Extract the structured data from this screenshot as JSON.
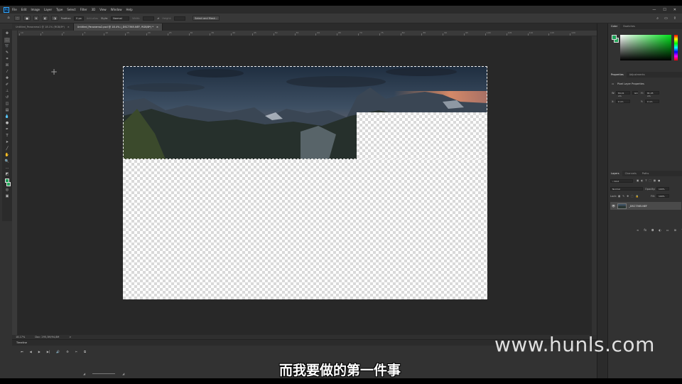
{
  "menubar": {
    "logo": "Ps",
    "items": [
      "File",
      "Edit",
      "Image",
      "Layer",
      "Type",
      "Select",
      "Filter",
      "3D",
      "View",
      "Window",
      "Help"
    ],
    "window_controls": [
      "—",
      "☐",
      "✕"
    ]
  },
  "options": {
    "feather_label": "Feather:",
    "feather_value": "0 px",
    "antialias_label": "Anti-alias",
    "style_label": "Style:",
    "style_value": "Normal",
    "width_label": "Width:",
    "height_label": "Height:",
    "select_mask_label": "Select and Mask..."
  },
  "tabs": [
    {
      "label": "Untitled_Panorama1 @ 18.1% (RGB/8*)",
      "close": "×"
    },
    {
      "label": "Untitled_Panorama2.psd @ 18.4% (_DSC7365.NEF, RGB/8*) *",
      "close": "×"
    }
  ],
  "ruler_numbers": [
    "10",
    "5",
    "0",
    "5",
    "10",
    "15",
    "20",
    "25",
    "30",
    "35",
    "40",
    "45",
    "50",
    "55",
    "60",
    "65",
    "70",
    "75",
    "80",
    "85",
    "90",
    "95",
    "100",
    "105",
    "110",
    "115",
    "120"
  ],
  "statusbar": {
    "zoom": "18.17%",
    "doc": "Doc: 295,3M/94,8M",
    "arrow": ">"
  },
  "timeline": {
    "title": "Timeline",
    "controls": [
      "⏮",
      "◀",
      "▶",
      "▶|",
      "🔊",
      "⚙",
      "✂",
      "⧉"
    ]
  },
  "color_panel": {
    "tabs": [
      "Color",
      "Swatches"
    ],
    "fg_color": "#1da158",
    "bg_color": "#26a65b"
  },
  "properties_panel": {
    "tabs": [
      "Properties",
      "Adjustments"
    ],
    "title": "Pixel Layer Properties",
    "w_label": "W:",
    "w_value": "84,41 cm",
    "go_label": "GO",
    "h_label": "H:",
    "h_value": "81,45 cm",
    "x_label": "X:",
    "x_value": "0 cm",
    "y_label": "Y:",
    "y_value": "0 cm"
  },
  "layers_panel": {
    "tabs": [
      "Layers",
      "Channels",
      "Paths"
    ],
    "filter_label": "Kind",
    "blend_mode": "Normal",
    "opacity_label": "Opacity:",
    "opacity_value": "100%",
    "lock_label": "Lock:",
    "fill_label": "Fill:",
    "fill_value": "100%",
    "layer_name": "_DSC7365.NEF"
  },
  "overlays": {
    "watermark": "www.hunls.com",
    "subtitle": "而我要做的第一件事"
  }
}
